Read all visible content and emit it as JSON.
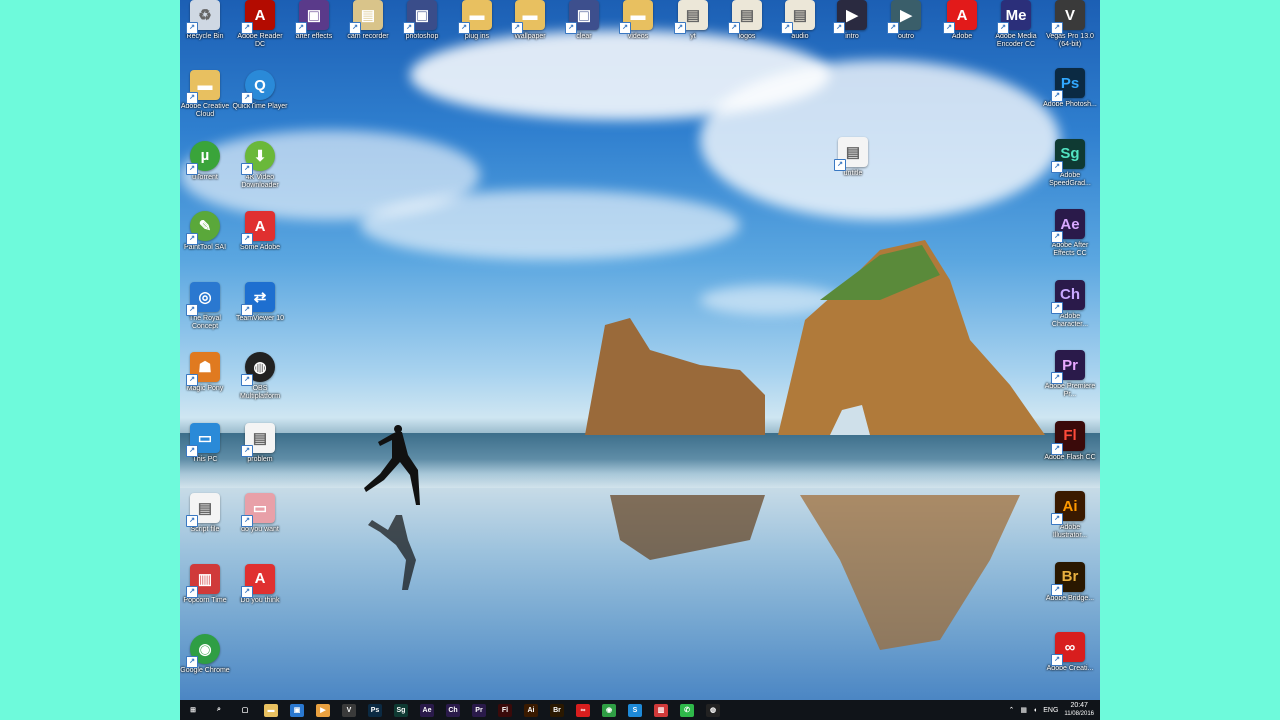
{
  "desktop": {
    "top_row": [
      {
        "label": "Recycle Bin",
        "icon": "recycle-bin-icon",
        "glyph": "♻",
        "color": "#cfd8e3"
      },
      {
        "label": "Adobe Reader DC",
        "icon": "pdf-icon",
        "glyph": "A",
        "color": "#b30b00"
      },
      {
        "label": "after effects",
        "icon": "file-icon",
        "glyph": "▣",
        "color": "#5a3a8a"
      },
      {
        "label": "cam recorder",
        "icon": "file-icon",
        "glyph": "▤",
        "color": "#d9c48a"
      },
      {
        "label": "photoshop",
        "icon": "file-icon",
        "glyph": "▣",
        "color": "#3a4d8a"
      },
      {
        "label": "plug ins",
        "icon": "folder-icon",
        "glyph": "▬",
        "color": "#e8c060"
      },
      {
        "label": "Wallpaper",
        "icon": "folder-icon",
        "glyph": "▬",
        "color": "#e8c060"
      },
      {
        "label": "clear",
        "icon": "file-icon",
        "glyph": "▣",
        "color": "#3d4f8d"
      },
      {
        "label": "videos",
        "icon": "folder-icon",
        "glyph": "▬",
        "color": "#e8c060"
      },
      {
        "label": "yt",
        "icon": "file-icon",
        "glyph": "▤",
        "color": "#ece7d8"
      },
      {
        "label": "logos",
        "icon": "file-icon",
        "glyph": "▤",
        "color": "#ece7d8"
      },
      {
        "label": "audio",
        "icon": "file-icon",
        "glyph": "▤",
        "color": "#ece7d8"
      },
      {
        "label": "intro",
        "icon": "video-icon",
        "glyph": "▶",
        "color": "#2a2a40"
      },
      {
        "label": "outro",
        "icon": "video-icon",
        "glyph": "▶",
        "color": "#3a5e6a"
      },
      {
        "label": "Adobe",
        "icon": "adobe-icon",
        "glyph": "A",
        "color": "#e21a1a"
      },
      {
        "label": "Adobe Media Encoder CC",
        "icon": "media-encoder-icon",
        "glyph": "Me",
        "color": "#2b2f7a"
      },
      {
        "label": "Vegas Pro 13.0 (64-bit)",
        "icon": "vegas-icon",
        "glyph": "V",
        "color": "#3a3a3a"
      }
    ],
    "left_col_1": [
      {
        "label": "Adobe Creative Cloud",
        "icon": "folder-icon",
        "glyph": "▬",
        "color": "#e8c060"
      },
      {
        "label": "uTorrent",
        "icon": "utorrent-icon",
        "glyph": "µ",
        "color": "#3aa43a",
        "round": true
      },
      {
        "label": "PaintTool SAI",
        "icon": "paint-icon",
        "glyph": "✎",
        "color": "#5aa83a",
        "round": true
      },
      {
        "label": "The Royal Concept",
        "icon": "app-icon",
        "glyph": "◎",
        "color": "#2a78d0"
      },
      {
        "label": "Magic Pony",
        "icon": "game-icon",
        "glyph": "☗",
        "color": "#e07a20"
      },
      {
        "label": "This PC",
        "icon": "pc-icon",
        "glyph": "▭",
        "color": "#2a8ad8"
      },
      {
        "label": "Script file",
        "icon": "file-icon",
        "glyph": "▤",
        "color": "#f4f4f4"
      },
      {
        "label": "Popcorn Time",
        "icon": "popcorn-icon",
        "glyph": "▥",
        "color": "#d03a3a"
      },
      {
        "label": "Google Chrome",
        "icon": "chrome-icon",
        "glyph": "◉",
        "color": "#2f9e44",
        "round": true
      }
    ],
    "left_col_2": [
      {
        "label": "QuickTime Player",
        "icon": "quicktime-icon",
        "glyph": "Q",
        "color": "#2a8ad8",
        "round": true
      },
      {
        "label": "4K Video Downloader",
        "icon": "downloader-icon",
        "glyph": "⬇",
        "color": "#6ab83a",
        "round": true
      },
      {
        "label": "Some Adobe",
        "icon": "pdf-icon",
        "glyph": "A",
        "color": "#e03030"
      },
      {
        "label": "TeamViewer 10",
        "icon": "teamviewer-icon",
        "glyph": "⇄",
        "color": "#1e6fd0"
      },
      {
        "label": "OBS Multiplatform",
        "icon": "obs-icon",
        "glyph": "◍",
        "color": "#222222",
        "round": true
      },
      {
        "label": "problem",
        "icon": "file-icon",
        "glyph": "▤",
        "color": "#f4f4f4"
      },
      {
        "label": "do you want",
        "icon": "image-icon",
        "glyph": "▭",
        "color": "#e8a0a8"
      },
      {
        "label": "Do you think",
        "icon": "pdf-icon",
        "glyph": "A",
        "color": "#e03030"
      }
    ],
    "right_col": [
      {
        "label": "Adobe Photosh...",
        "icon": "photoshop-icon",
        "glyph": "Ps",
        "color": "#0b2a43",
        "fg": "#31a8ff"
      },
      {
        "label": "Adobe SpeedGrad...",
        "icon": "speedgrade-icon",
        "glyph": "Sg",
        "color": "#0f3a33",
        "fg": "#52e3c2"
      },
      {
        "label": "Adobe After Effects CC",
        "icon": "after-effects-icon",
        "glyph": "Ae",
        "color": "#2a1a4a",
        "fg": "#d8a8ff"
      },
      {
        "label": "Adobe Character...",
        "icon": "character-animator-icon",
        "glyph": "Ch",
        "color": "#2a1a4a",
        "fg": "#c8a8ff"
      },
      {
        "label": "Adobe Premiere Pr...",
        "icon": "premiere-icon",
        "glyph": "Pr",
        "color": "#2a1a4a",
        "fg": "#e8a8ff"
      },
      {
        "label": "Adobe Flash CC",
        "icon": "flash-icon",
        "glyph": "Fl",
        "color": "#3a0a0a",
        "fg": "#ff4a3a"
      },
      {
        "label": "Adobe Illustrator...",
        "icon": "illustrator-icon",
        "glyph": "Ai",
        "color": "#3a1a00",
        "fg": "#ff9a00"
      },
      {
        "label": "Adobe Bridge...",
        "icon": "bridge-icon",
        "glyph": "Br",
        "color": "#2a1800",
        "fg": "#e8b040"
      },
      {
        "label": "Adobe Creati...",
        "icon": "creative-cloud-icon",
        "glyph": "∞",
        "color": "#d81e1e",
        "fg": "#ffffff"
      }
    ],
    "loose_file": {
      "label": "untitle",
      "icon": "document-icon",
      "glyph": "▤",
      "color": "#f4f4f4"
    }
  },
  "taskbar": {
    "apps": [
      {
        "name": "start-button",
        "glyph": "⊞",
        "color": "transparent"
      },
      {
        "name": "search-icon",
        "glyph": "⌕",
        "color": "transparent"
      },
      {
        "name": "task-view-icon",
        "glyph": "▢",
        "color": "transparent"
      },
      {
        "name": "file-explorer-icon",
        "glyph": "▬",
        "color": "#e8c060"
      },
      {
        "name": "store-icon",
        "glyph": "▣",
        "color": "#2a78d0"
      },
      {
        "name": "media-icon",
        "glyph": "▶",
        "color": "#e8a040"
      },
      {
        "name": "vegas-taskbar-icon",
        "glyph": "V",
        "color": "#3a3a3a"
      },
      {
        "name": "photoshop-taskbar-icon",
        "glyph": "Ps",
        "color": "#0b2a43"
      },
      {
        "name": "speedgrade-taskbar-icon",
        "glyph": "Sg",
        "color": "#0f3a33"
      },
      {
        "name": "after-effects-taskbar-icon",
        "glyph": "Ae",
        "color": "#2a1a4a"
      },
      {
        "name": "character-animator-taskbar-icon",
        "glyph": "Ch",
        "color": "#2a1a4a"
      },
      {
        "name": "premiere-taskbar-icon",
        "glyph": "Pr",
        "color": "#2a1a4a"
      },
      {
        "name": "flash-taskbar-icon",
        "glyph": "Fl",
        "color": "#3a0a0a"
      },
      {
        "name": "illustrator-taskbar-icon",
        "glyph": "Ai",
        "color": "#3a1a00"
      },
      {
        "name": "bridge-taskbar-icon",
        "glyph": "Br",
        "color": "#2a1800"
      },
      {
        "name": "creative-cloud-taskbar-icon",
        "glyph": "∞",
        "color": "#d81e1e"
      },
      {
        "name": "chrome-taskbar-icon",
        "glyph": "◉",
        "color": "#2f9e44"
      },
      {
        "name": "skype-taskbar-icon",
        "glyph": "S",
        "color": "#1e8ad8"
      },
      {
        "name": "popcorn-taskbar-icon",
        "glyph": "▥",
        "color": "#d03a3a"
      },
      {
        "name": "whatsapp-taskbar-icon",
        "glyph": "✆",
        "color": "#2fb84a"
      },
      {
        "name": "obs-taskbar-icon",
        "glyph": "◍",
        "color": "#222222"
      }
    ],
    "tray": {
      "lang": "ENG",
      "time": "20:47",
      "date": "11/08/2016"
    }
  }
}
